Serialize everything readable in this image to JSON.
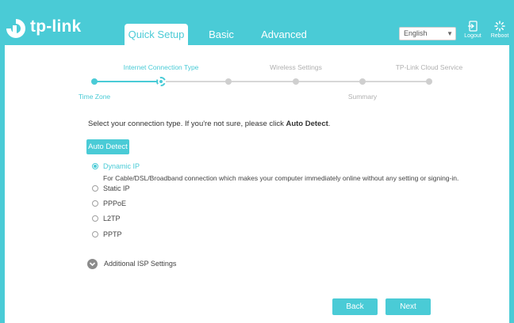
{
  "brand": {
    "logo_text": "tp-link",
    "accent_color": "#4acbd6"
  },
  "nav": {
    "tabs": [
      {
        "label": "Quick Setup",
        "active": true
      },
      {
        "label": "Basic",
        "active": false
      },
      {
        "label": "Advanced",
        "active": false
      }
    ]
  },
  "header": {
    "language": "English",
    "logout_label": "Logout",
    "reboot_label": "Reboot"
  },
  "wizard": {
    "steps": [
      {
        "label": "Time Zone",
        "state": "done"
      },
      {
        "label": "Internet Connection Type",
        "state": "current"
      },
      {
        "label": "",
        "state": "pending"
      },
      {
        "label": "Wireless Settings",
        "state": "pending"
      },
      {
        "label": "Summary",
        "state": "pending"
      },
      {
        "label": "TP-Link Cloud Service",
        "state": "pending"
      }
    ]
  },
  "main": {
    "intro_text": "Select your connection type. If you're not sure, please click ",
    "intro_bold": "Auto Detect",
    "intro_end": ".",
    "auto_detect_label": "Auto Detect",
    "options": [
      {
        "label": "Dynamic IP",
        "selected": true
      },
      {
        "label": "Static IP",
        "selected": false
      },
      {
        "label": "PPPoE",
        "selected": false
      },
      {
        "label": "L2TP",
        "selected": false
      },
      {
        "label": "PPTP",
        "selected": false
      }
    ],
    "dynamic_description": "For Cable/DSL/Broadband connection which makes your computer immediately online without any setting or signing-in.",
    "additional_isp_label": "Additional ISP Settings",
    "back_label": "Back",
    "next_label": "Next"
  }
}
